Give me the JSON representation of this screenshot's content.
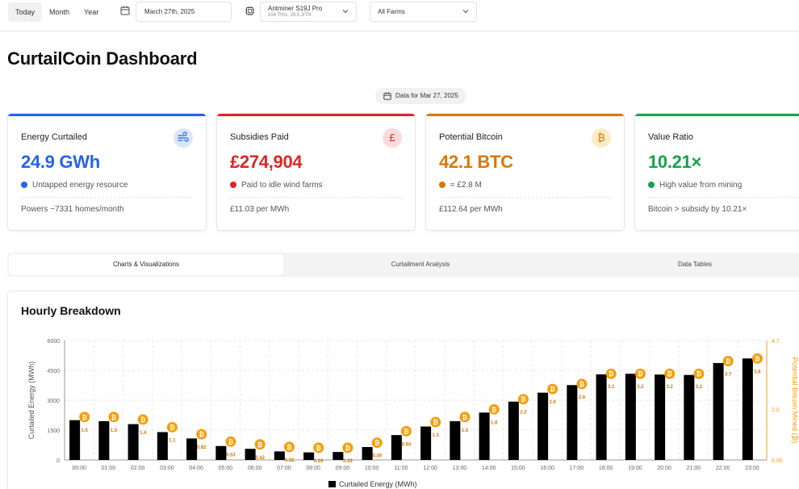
{
  "toolbar": {
    "periods": [
      "Today",
      "Month",
      "Year"
    ],
    "active_period": "Today",
    "date_value": "March 27th, 2025",
    "miner_name": "Antminer S19J Pro",
    "miner_spec": "104 TH/s, 29.5 J/TH",
    "farm_value": "All Farms"
  },
  "page_title": "CurtailCoin Dashboard",
  "date_badge": "Data for Mar 27, 2025",
  "cards": [
    {
      "title": "Energy Curtailed",
      "value": "24.9 GWh",
      "sub": "Untapped energy resource",
      "foot": "Powers ~7331 homes/month",
      "color": "#2563eb",
      "icon_bg": "#dbe6fb",
      "icon": "wind-icon"
    },
    {
      "title": "Subsidies Paid",
      "value": "£274,904",
      "sub": "Paid to idle wind farms",
      "foot": "£11.03 per MWh",
      "color": "#dc2626",
      "icon_bg": "#fbdada",
      "icon": "pound-icon",
      "icon_glyph": "£"
    },
    {
      "title": "Potential Bitcoin",
      "value": "42.1 BTC",
      "sub": "≈ £2.8 M",
      "foot": "£112.64 per MWh",
      "color": "#d97706",
      "icon_bg": "#fbecc8",
      "icon": "bitcoin-icon",
      "icon_glyph": "₿"
    },
    {
      "title": "Value Ratio",
      "value": "10.21×",
      "sub": "High value from mining",
      "foot": "Bitcoin > subsidy by 10.21×",
      "color": "#16a34a",
      "icon": "none"
    }
  ],
  "tabs": [
    "Charts & Visualizations",
    "Curtailment Analysis",
    "Data Tables"
  ],
  "active_tab": "Charts & Visualizations",
  "chart_section_title": "Hourly Breakdown",
  "chart_data": {
    "type": "bar",
    "categories": [
      "00:00",
      "01:00",
      "02:00",
      "03:00",
      "04:00",
      "05:00",
      "06:00",
      "07:00",
      "08:00",
      "09:00",
      "10:00",
      "11:00",
      "12:00",
      "13:00",
      "14:00",
      "15:00",
      "16:00",
      "17:00",
      "18:00",
      "19:00",
      "20:00",
      "21:00",
      "22:00",
      "23:00"
    ],
    "series": [
      {
        "name": "Curtailed Energy (MWh)",
        "axis": "left",
        "color": "#000000",
        "values": [
          2000,
          1950,
          1800,
          1400,
          1080,
          700,
          560,
          430,
          380,
          400,
          650,
          1250,
          1680,
          1950,
          2380,
          2930,
          3380,
          3760,
          4300,
          4330,
          4290,
          4270,
          4870,
          5100
        ]
      },
      {
        "axis": "right",
        "color": "#f59e0b",
        "display": "bitcoin-markers",
        "values": [
          1.5,
          1.5,
          1.4,
          1.1,
          0.82,
          0.53,
          0.42,
          0.32,
          0.29,
          0.29,
          0.49,
          0.94,
          1.3,
          1.5,
          1.8,
          2.2,
          2.6,
          2.8,
          3.2,
          3.2,
          3.2,
          3.2,
          3.7,
          3.8
        ]
      }
    ],
    "ylabel": "Curtailed Energy (MWh)",
    "y2label": "Potential Bitcoin Mined (₿)",
    "yticks": [
      "0",
      "1500",
      "3000",
      "4500",
      "6000"
    ],
    "y2ticks": [
      "0.00",
      "2.0",
      "4.7"
    ],
    "ylim": [
      0,
      6000
    ],
    "y2lim": [
      0,
      4.7
    ],
    "legend": "Curtailed Energy (MWh)",
    "legend_position": "bottom",
    "grid": true
  }
}
